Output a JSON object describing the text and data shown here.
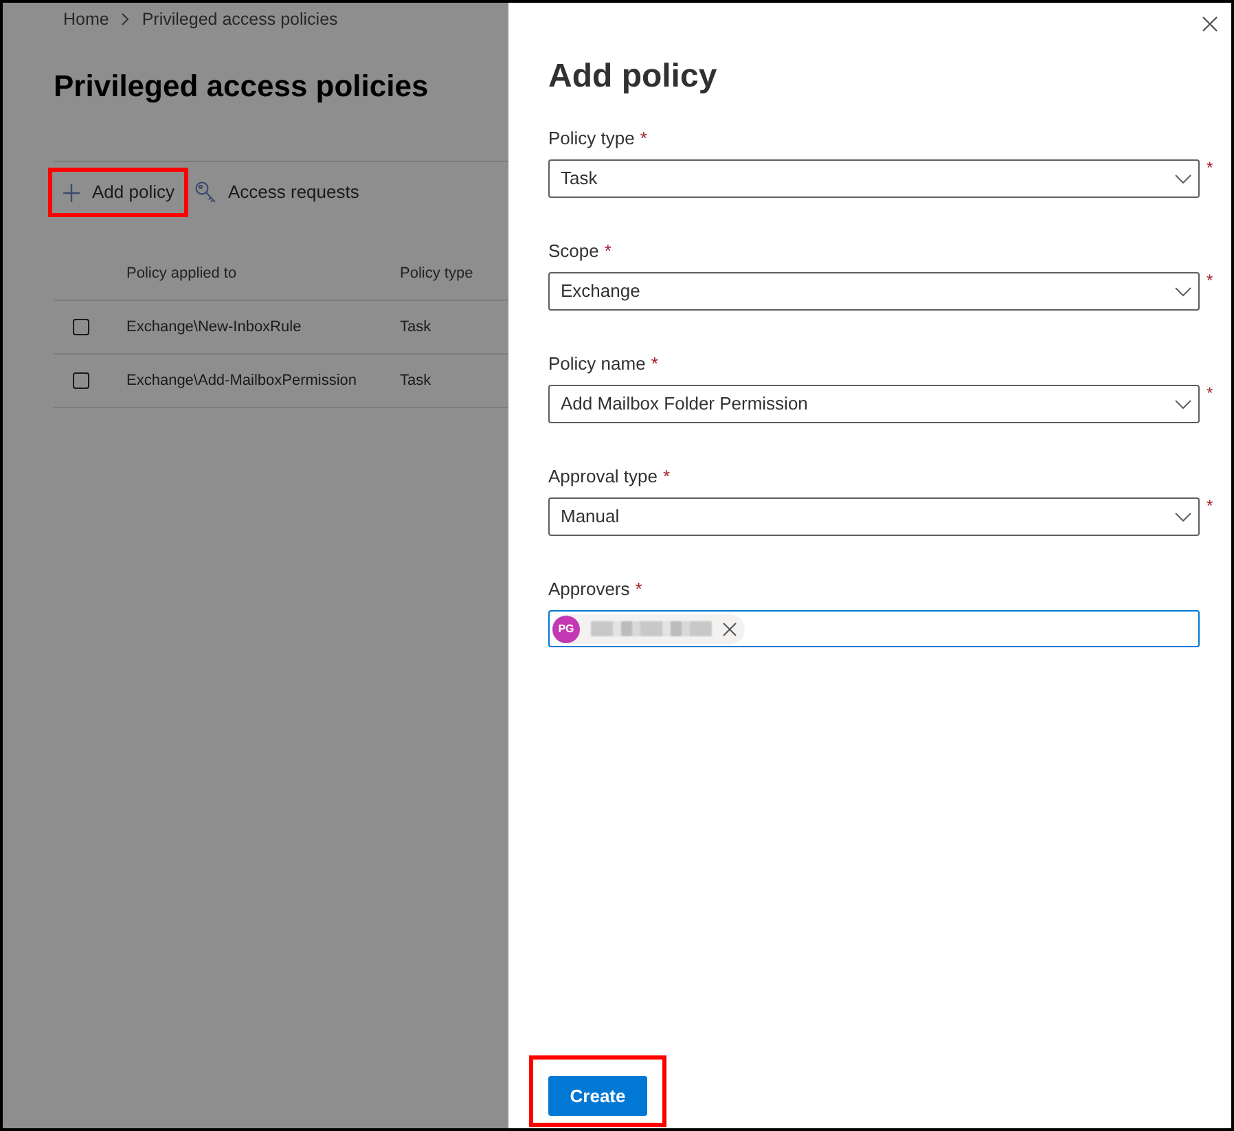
{
  "breadcrumb": [
    {
      "label": "Home"
    },
    {
      "label": "Privileged access policies"
    }
  ],
  "page": {
    "title": "Privileged access policies"
  },
  "toolbar": [
    {
      "kind": "add",
      "label": "Add policy",
      "highlighted": true
    },
    {
      "kind": "key",
      "label": "Access requests",
      "highlighted": false
    }
  ],
  "table": {
    "columns": [
      "Policy applied to",
      "Policy type"
    ],
    "rows": [
      {
        "checked": false,
        "cells": [
          "Exchange\\New-InboxRule",
          "Task"
        ]
      },
      {
        "checked": false,
        "cells": [
          "Exchange\\Add-MailboxPermission",
          "Task"
        ]
      }
    ]
  },
  "panel": {
    "title": "Add policy",
    "fields": [
      {
        "kind": "dropdown",
        "label": "Policy type",
        "required_mark": "*",
        "value": "Task",
        "side_mark": "*",
        "focused": false
      },
      {
        "kind": "dropdown",
        "label": "Scope",
        "required_mark": "*",
        "value": "Exchange",
        "side_mark": "*",
        "focused": false
      },
      {
        "kind": "dropdown",
        "label": "Policy name",
        "required_mark": "*",
        "value": "Add Mailbox Folder Permission",
        "side_mark": "*",
        "focused": false
      },
      {
        "kind": "dropdown",
        "label": "Approval type",
        "required_mark": "*",
        "value": "Manual",
        "side_mark": "*",
        "focused": false
      },
      {
        "kind": "people",
        "label": "Approvers",
        "required_mark": "*",
        "focused": true,
        "people": [
          {
            "initials": "PG",
            "color": "#c239b3",
            "redacted": true
          }
        ]
      }
    ],
    "actions": [
      {
        "kind": "primary",
        "label": "Create",
        "highlighted": true
      }
    ]
  }
}
